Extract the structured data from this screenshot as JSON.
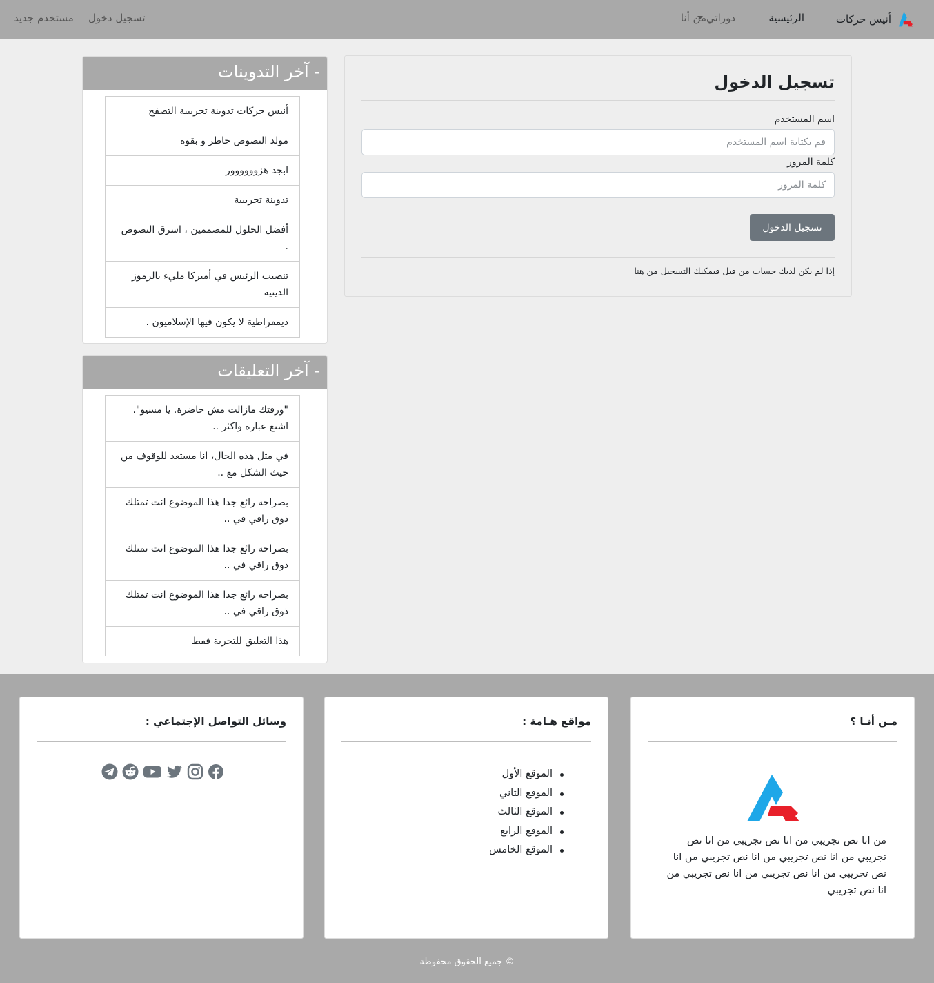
{
  "navbar": {
    "brand_name": "أنيس حركات",
    "brand_logo_icon": "brand-logo-icon",
    "links": {
      "home": "الرئيسية",
      "courses": "دوراتي",
      "about": "من أنا",
      "login": "تسجيل دخول",
      "register": "مستخدم جديد"
    }
  },
  "login": {
    "title": "تسجيل الدخول",
    "username_label": "اسم المستخدم",
    "username_placeholder": "قم بكتابة اسم المستخدم",
    "password_label": "كلمة المرور",
    "password_placeholder": "كلمة المرور",
    "submit_label": "تسجيل الدخول",
    "register_prefix": "إذا لم يكن لديك حساب من قبل فيمكنك التسجيل",
    "register_link": "من هنا"
  },
  "sidebar": {
    "posts": {
      "title": "- آخر التدوينات",
      "items": [
        "أنيس حركات تدوينة تجريبية التصفح",
        "مولد النصوص حاظر و بقوة",
        "ابجد هزوووووور",
        "تدوينة تجريبية",
        "أفضل الحلول للمصممين ، اسرق النصوص .",
        "تنصيب الرئيس في أميركا مليء بالرموز الدينية",
        "ديمقراطية لا يكون فيها الإسلاميون ."
      ]
    },
    "comments": {
      "title": "- آخر التعليقات",
      "items": [
        "\"ورقتك مازالت مش حاضرة. يا مسيو\". اشنع عبارة واكثر ..",
        "في مثل هذه الحال، انا مستعد للوقوف من حيث الشكل مع ..",
        "بصراحه رائع جدا هذا الموضوع انت تمتلك ذوق راقي في ..",
        "بصراحه رائع جدا هذا الموضوع انت تمتلك ذوق راقي في ..",
        "بصراحه رائع جدا هذا الموضوع انت تمتلك ذوق راقي في ..",
        "هذا التعليق للتجربة فقط"
      ]
    }
  },
  "footer": {
    "about": {
      "title": "مـن أنـا ؟",
      "text": "من انا نص تجريبي من انا نص تجريبي من انا نص تجريبي من انا نص تجريبي من انا نص تجريبي من انا نص تجريبي من انا نص تجريبي من انا نص تجريبي من انا نص تجريبي"
    },
    "sites": {
      "title": "مواقع هـامة :",
      "items": [
        "الموقع الأول",
        "الموقع الثاني",
        "الموقع الثالث",
        "الموقع الرابع",
        "الموقع الخامس"
      ]
    },
    "social": {
      "title": "وسائل التواصل الإجتماعي :",
      "icons": [
        "facebook-icon",
        "instagram-icon",
        "twitter-icon",
        "youtube-icon",
        "reddit-icon",
        "telegram-icon"
      ]
    },
    "copyright": "© جميع الحقوق محفوظة"
  },
  "colors": {
    "navbar_bg": "#a9a9a9",
    "page_bg": "#eeeeee",
    "button_bg": "#6c757d",
    "logo_blue": "#1ea7e8",
    "logo_red": "#e8202a",
    "icon_gray": "#6c757d"
  }
}
